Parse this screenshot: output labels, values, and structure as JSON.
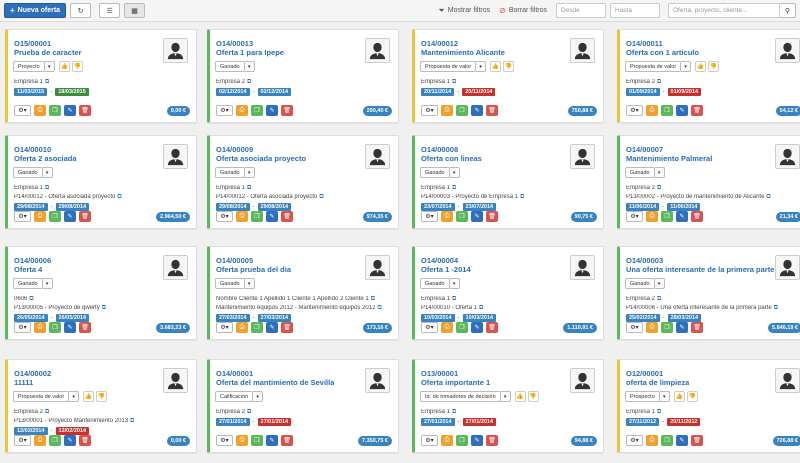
{
  "toolbar": {
    "new_label": "Nueva oferta",
    "show_filters": "Mostrar filtros",
    "clear_filters": "Borrar filtros",
    "from_placeholder": "Desde",
    "to_placeholder": "Hasta",
    "search_placeholder": "Oferta, proyecto, cliente..."
  },
  "colors": {
    "accent": "#2e6fbd",
    "yellow": "#e8c53b",
    "green": "#5cb85c",
    "date_green": "#3f8c3f",
    "date_red": "#c9302c"
  },
  "cards": [
    {
      "code": "O15/00001",
      "title": "Prueba de caracter",
      "status": "Proyecto",
      "thumbs": true,
      "lines": [
        "Empresa 1"
      ],
      "start": "11/03/2015",
      "end": "18/03/2015",
      "end_color": "green",
      "total": "0,00 €",
      "border": "yellow"
    },
    {
      "code": "O14/00013",
      "title": "Oferta 1 para Ipepe",
      "status": "Ganado",
      "thumbs": false,
      "lines": [
        "Empresa 2"
      ],
      "start": "02/12/2014",
      "end": "02/12/2014",
      "end_color": "blue",
      "total": "290,40 €",
      "border": "green"
    },
    {
      "code": "O14/00012",
      "title": "Mantenimiento Alicante",
      "status": "Propuesta de valor",
      "thumbs": true,
      "lines": [
        "Empresa 1"
      ],
      "start": "20/11/2014",
      "end": "20/11/2014",
      "end_color": "red",
      "total": "750,88 €",
      "border": "yellow"
    },
    {
      "code": "O14/00011",
      "title": "Oferta con 1 articulo",
      "status": "Propuesta de valor",
      "thumbs": true,
      "lines": [
        "Empresa 2"
      ],
      "start": "01/09/2014",
      "end": "01/09/2014",
      "end_color": "red",
      "total": "54,12 €",
      "border": "yellow"
    },
    {
      "code": "O14/00010",
      "title": "Oferta 2 asociada",
      "status": "Ganado",
      "thumbs": false,
      "lines": [
        "Empresa 1",
        "P14/00012 - Oferta asociada proyecto"
      ],
      "start": "29/08/2014",
      "end": "29/08/2014",
      "end_color": "blue",
      "total": "2.964,50 €",
      "border": "green"
    },
    {
      "code": "O14/00009",
      "title": "Oferta asociada proyecto",
      "status": "Ganado",
      "thumbs": false,
      "lines": [
        "Empresa 1",
        "P14/00012 - Oferta asociada proyecto"
      ],
      "start": "29/08/2014",
      "end": "29/08/2014",
      "end_color": "blue",
      "total": "974,35 €",
      "border": "green"
    },
    {
      "code": "O14/00008",
      "title": "Oferta con lineas",
      "status": "Ganado",
      "thumbs": false,
      "lines": [
        "Empresa 1",
        "P14/00003 - Proyecto de Empresa 1"
      ],
      "start": "23/07/2014",
      "end": "23/07/2014",
      "end_color": "blue",
      "total": "90,75 €",
      "border": "green"
    },
    {
      "code": "O14/00007",
      "title": "Mantenimiento Palmeral",
      "status": "Ganado",
      "thumbs": false,
      "lines": [
        "Empresa 2",
        "P13/00002 - Proyecto de mantenimiento de Alicante"
      ],
      "start": "11/06/2014",
      "end": "11/06/2014",
      "end_color": "blue",
      "total": "21,34 €",
      "border": "green"
    },
    {
      "code": "O14/00006",
      "title": "Oferta 4",
      "status": "Ganado",
      "thumbs": false,
      "lines": [
        "0606",
        "P13/00005 - Proyecto de qwerty"
      ],
      "start": "26/05/2014",
      "end": "26/05/2014",
      "end_color": "blue",
      "total": "3.683,23 €",
      "border": "green"
    },
    {
      "code": "O14/00005",
      "title": "Oferta prueba del dia",
      "status": "Ganado",
      "thumbs": false,
      "lines": [
        "Nombre Cliente 1 Apellido 1 Cliente 1 Apellido 2 Cliente 1",
        "Mantenimiento equipos 2012 - Mantenimiento equipos 2012"
      ],
      "start": "27/03/2014",
      "end": "27/03/2014",
      "end_color": "blue",
      "total": "173,16 €",
      "border": "green"
    },
    {
      "code": "O14/00004",
      "title": "Oferta 1 -2014",
      "status": "Ganado",
      "thumbs": false,
      "lines": [
        "Empresa 1",
        "P14/00010 - Oferta 1"
      ],
      "start": "10/03/2014",
      "end": "10/03/2014",
      "end_color": "blue",
      "total": "1.110,91 €",
      "border": "green"
    },
    {
      "code": "O14/00003",
      "title": "Una oferta interesante de la primera parte",
      "status": "Ganado",
      "thumbs": false,
      "lines": [
        "Empresa 2",
        "P14/00006 - Una oferta interesante de la primera parte"
      ],
      "start": "25/02/2014",
      "end": "28/03/2014",
      "end_color": "blue",
      "total": "5.846,19 €",
      "border": "green"
    },
    {
      "code": "O14/00002",
      "title": "11111",
      "status": "Propuesta de valor",
      "thumbs": true,
      "lines": [
        "Empresa 2",
        "P13/00001 - Proyecto Mantenimiento 2013"
      ],
      "start": "12/02/2014",
      "end": "12/02/2014",
      "end_color": "red",
      "total": "0,00 €",
      "border": "yellow"
    },
    {
      "code": "O14/00001",
      "title": "Oferta del mantimiento de Sevilla",
      "status": "Calificación",
      "thumbs": false,
      "lines": [
        "Empresa 2"
      ],
      "start": "27/01/2014",
      "end": "27/01/2014",
      "end_color": "red",
      "total": "7.350,75 €",
      "border": "green"
    },
    {
      "code": "O13/00001",
      "title": "Oferta importante 1",
      "status": "Id. de tomadores de decisión",
      "thumbs": true,
      "lines": [
        "Empresa 1"
      ],
      "start": "27/01/2014",
      "end": "27/01/2014",
      "end_color": "red",
      "total": "94,88 €",
      "border": "green"
    },
    {
      "code": "O12/00001",
      "title": "oferta de limpieza",
      "status": "Prospecto",
      "thumbs": true,
      "lines": [
        "Empresa 1"
      ],
      "start": "27/11/2012",
      "end": "20/11/2012",
      "end_color": "red",
      "total": "726,88 €",
      "border": "yellow"
    }
  ]
}
